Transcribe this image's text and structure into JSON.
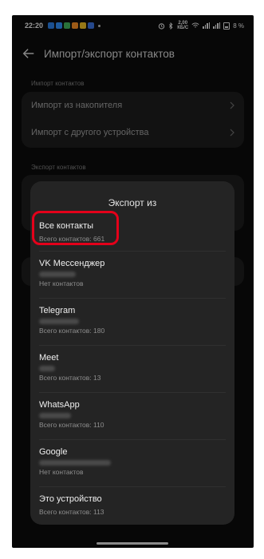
{
  "status_bar": {
    "time": "22:20",
    "net_speed_value": "2,00",
    "net_speed_unit": "КБ/С",
    "battery": "8 %"
  },
  "header": {
    "title": "Импорт/экспорт контактов"
  },
  "import_section": {
    "label": "Импорт контактов",
    "items": [
      {
        "label": "Импорт из накопителя"
      },
      {
        "label": "Импорт с другого устройства"
      }
    ]
  },
  "export_section": {
    "label": "Экспорт контактов"
  },
  "sheet": {
    "title": "Экспорт из",
    "sources": [
      {
        "name": "Все контакты",
        "count": "Всего контактов: 661"
      },
      {
        "name": "VK Мессенджер",
        "count": "Нет контактов"
      },
      {
        "name": "Telegram",
        "count": "Всего контактов: 180"
      },
      {
        "name": "Meet",
        "count": "Всего контактов: 13"
      },
      {
        "name": "WhatsApp",
        "count": "Всего контактов: 110"
      },
      {
        "name": "Google",
        "count": "Нет контактов"
      },
      {
        "name": "Это устройство",
        "count": "Всего контактов: 113"
      }
    ]
  },
  "colors": {
    "highlight": "#e4001a",
    "sheet_bg": "#242424",
    "screen_bg": "#0c0c0c"
  }
}
